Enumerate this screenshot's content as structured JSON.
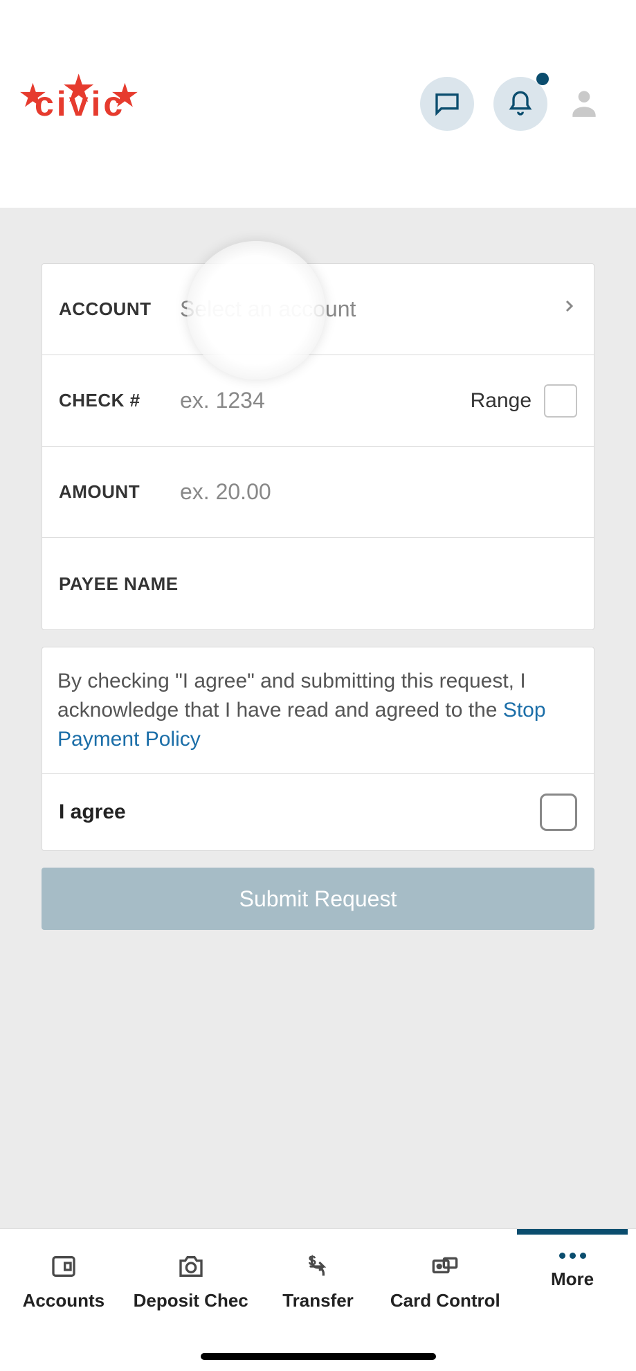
{
  "header": {
    "logo_text": "civic"
  },
  "form": {
    "account": {
      "label": "ACCOUNT",
      "placeholder": "Select an account"
    },
    "check": {
      "label": "CHECK #",
      "placeholder": "ex. 1234",
      "range_label": "Range"
    },
    "amount": {
      "label": "AMOUNT",
      "placeholder": "ex. 20.00"
    },
    "payee": {
      "label": "PAYEE NAME"
    }
  },
  "disclosure": {
    "text_prefix": "By checking \"I agree\" and submitting this request, I acknowledge that I have read and agreed to the ",
    "link_text": "Stop Payment Policy"
  },
  "agree": {
    "label": "I agree"
  },
  "submit": {
    "label": "Submit Request"
  },
  "nav": {
    "accounts": "Accounts",
    "deposit": "Deposit Chec",
    "transfer": "Transfer",
    "card": "Card Control",
    "more": "More"
  }
}
